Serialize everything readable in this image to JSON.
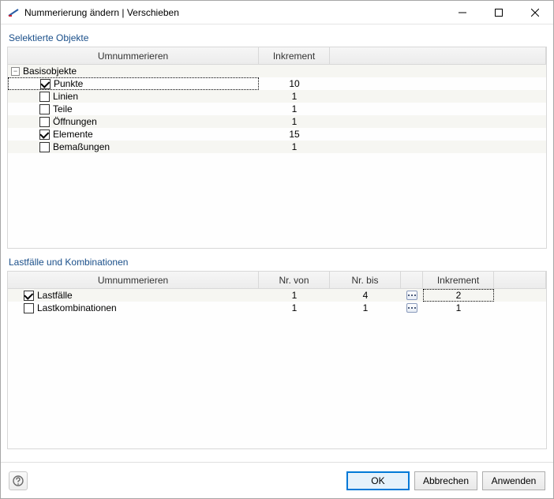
{
  "window": {
    "title": "Nummerierung ändern | Verschieben"
  },
  "section1": {
    "label": "Selektierte Objekte",
    "headers": {
      "renumber": "Umnummerieren",
      "increment": "Inkrement"
    },
    "group": "Basisobjekte",
    "items": [
      {
        "label": "Punkte",
        "checked": true,
        "increment": 10
      },
      {
        "label": "Linien",
        "checked": false,
        "increment": 1
      },
      {
        "label": "Teile",
        "checked": false,
        "increment": 1
      },
      {
        "label": "Öffnungen",
        "checked": false,
        "increment": 1
      },
      {
        "label": "Elemente",
        "checked": true,
        "increment": 15
      },
      {
        "label": "Bemaßungen",
        "checked": false,
        "increment": 1
      }
    ]
  },
  "section2": {
    "label": "Lastfälle und Kombinationen",
    "headers": {
      "renumber": "Umnummerieren",
      "from": "Nr. von",
      "to": "Nr. bis",
      "increment": "Inkrement"
    },
    "items": [
      {
        "label": "Lastfälle",
        "checked": true,
        "from": 1,
        "to": 4,
        "increment": 2
      },
      {
        "label": "Lastkombinationen",
        "checked": false,
        "from": 1,
        "to": 1,
        "increment": 1
      }
    ]
  },
  "footer": {
    "ok": "OK",
    "cancel": "Abbrechen",
    "apply": "Anwenden"
  }
}
